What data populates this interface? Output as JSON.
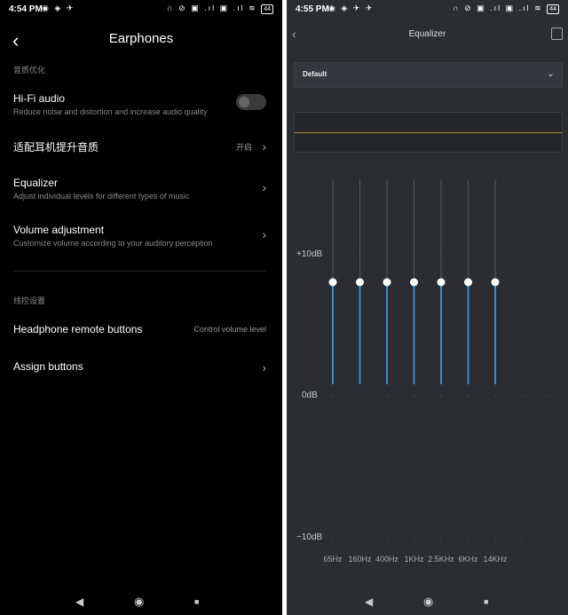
{
  "left": {
    "status": {
      "time": "4:54 PM",
      "left_icons": "◉ ◈ ✈",
      "right_icons": "∩ ⊘ ▣ .ıl ▣ .ıl ≋",
      "battery": "44"
    },
    "title": "Earphones",
    "section1": "音质优化",
    "hifi": {
      "title": "Hi-Fi audio",
      "subtitle": "Reduce noise and distortion and increase audio quality",
      "enabled": false
    },
    "adapt": {
      "title": "适配耳机提升音质",
      "value": "开启"
    },
    "equalizer": {
      "title": "Equalizer",
      "subtitle": "Adjust individual levels for different types of music"
    },
    "volume": {
      "title": "Volume adjustment",
      "subtitle": "Customize volume according to your auditory perception"
    },
    "section2": "线控设置",
    "remote": {
      "title": "Headphone remote buttons",
      "value": "Control volume level"
    },
    "assign": {
      "title": "Assign buttons"
    },
    "nav": {
      "back": "◀",
      "home": "◉",
      "recent": "■"
    }
  },
  "right": {
    "status": {
      "time": "4:55 PM",
      "left_icons": "◉ ◈ ✈ ✈",
      "right_icons": "∩ ⊘ ▣ .ıl ▣ .ıl ≋",
      "battery": "44"
    },
    "title": "Equalizer",
    "preset": "Default",
    "db_labels": {
      "top": "+10dB",
      "mid": "0dB",
      "bottom": "−10dB"
    },
    "bands": [
      {
        "freq": "65Hz",
        "level_db": 0
      },
      {
        "freq": "160Hz",
        "level_db": 0
      },
      {
        "freq": "400Hz",
        "level_db": 0
      },
      {
        "freq": "1KHz",
        "level_db": 0
      },
      {
        "freq": "2.5KHz",
        "level_db": 0
      },
      {
        "freq": "6KHz",
        "level_db": 0
      },
      {
        "freq": "14KHz",
        "level_db": 0
      }
    ],
    "colors": {
      "accent": "#2e8fd6",
      "curve": "#a58a3a"
    },
    "nav": {
      "back": "◀",
      "home": "◉",
      "recent": "■"
    }
  }
}
